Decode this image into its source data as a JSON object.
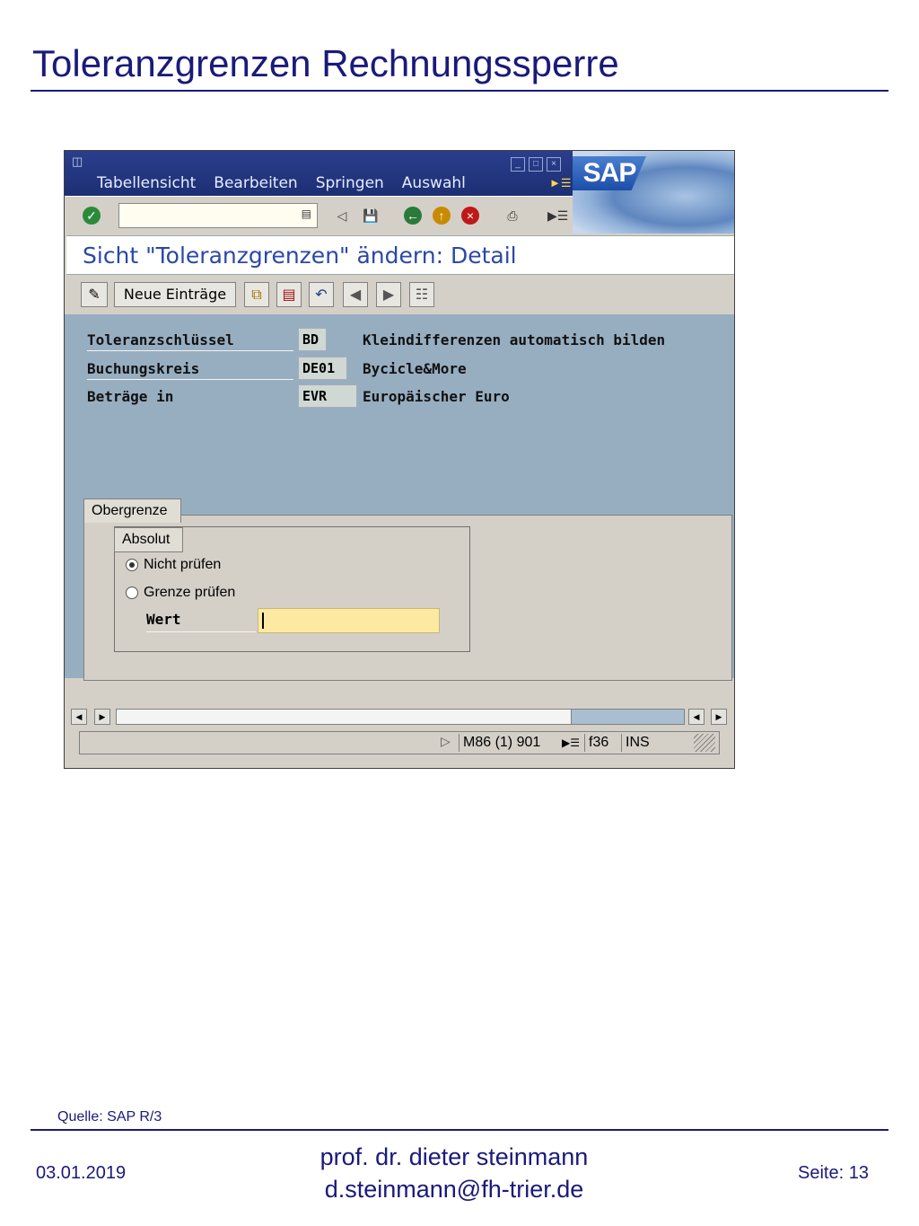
{
  "slide": {
    "title": "Toleranzgrenzen Rechnungssperre",
    "source": "Quelle: SAP R/3",
    "date": "03.01.2019",
    "author_line1": "prof. dr. dieter steinmann",
    "author_line2": "d.steinmann@fh-trier.de",
    "page": "Seite: 13"
  },
  "menubar": {
    "items": [
      "Tabellensicht",
      "Bearbeiten",
      "Springen",
      "Auswahl"
    ],
    "logo": "SAP"
  },
  "toolbar": {
    "command_value": "",
    "icons": [
      "enter-icon",
      "back-arrow-icon",
      "save-icon",
      "back-icon",
      "exit-icon",
      "cancel-icon",
      "print-icon",
      "find-icon"
    ]
  },
  "screen_title": "Sicht \"Toleranzgrenzen\" ändern: Detail",
  "app_toolbar": {
    "new_entries_label": "Neue Einträge"
  },
  "fields": {
    "rows": [
      {
        "label": "Toleranzschlüssel",
        "value": "BD",
        "description": "Kleindifferenzen automatisch bilden"
      },
      {
        "label": "Buchungskreis",
        "value": "DE01",
        "description": "Bycicle&More"
      },
      {
        "label": "Beträge in",
        "value": "EVR",
        "description": "Europäischer Euro"
      }
    ]
  },
  "tab": {
    "label": "Obergrenze",
    "group_label": "Absolut",
    "options": [
      {
        "label": "Nicht prüfen",
        "selected": true
      },
      {
        "label": "Grenze prüfen",
        "selected": false
      }
    ],
    "value_label": "Wert",
    "value": ""
  },
  "statusbar": {
    "transaction": "M86 (1) 901",
    "server": "f36",
    "mode": "INS"
  },
  "colors": {
    "menubar": "#1c2f74",
    "content": "#97aec1",
    "slide_accent": "#1a1a7a",
    "input_highlight": "#fde9a2"
  }
}
